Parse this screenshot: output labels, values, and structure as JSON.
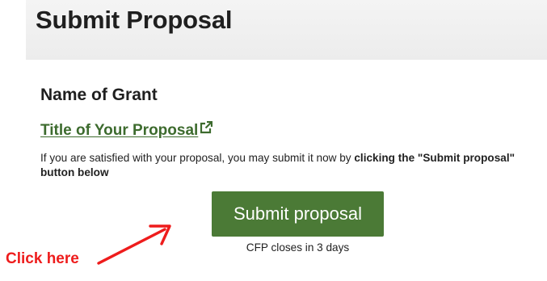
{
  "header": {
    "title": "Submit Proposal"
  },
  "proposal": {
    "grant_name": "Name of Grant",
    "title_link": "Title of Your Proposal",
    "title_link_icon": "external-link-icon",
    "instructions_prefix": "If you are satisfied with your proposal, you may submit it now by ",
    "instructions_bold": "clicking the \"Submit proposal\" button below"
  },
  "actions": {
    "submit_label": "Submit proposal",
    "deadline_text": "CFP closes in 3 days"
  },
  "annotation": {
    "label": "Click here",
    "arrow_icon": "red-arrow-icon"
  },
  "colors": {
    "accent_green": "#4b7a36",
    "link_green": "#3d6b2e",
    "annotation_red": "#ee1c1c",
    "header_bg": "#f0f0f0"
  }
}
